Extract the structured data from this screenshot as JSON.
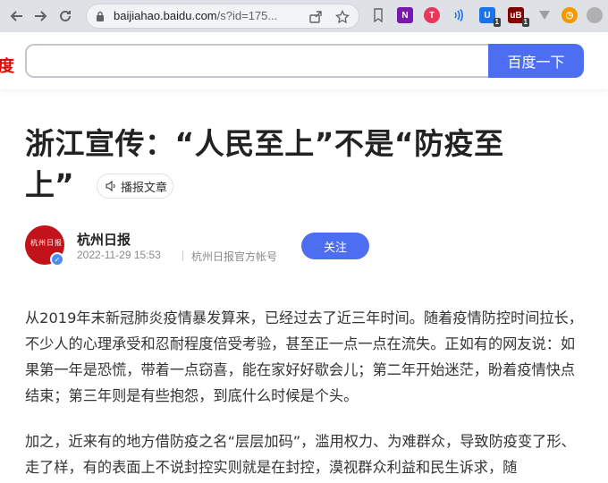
{
  "browser": {
    "url_host": "baijiahao.baidu.com",
    "url_path": "/s?id=175...",
    "icons": [
      "back-arrow-icon",
      "forward-arrow-icon",
      "reload-icon",
      "lock-icon",
      "share-icon",
      "star-icon",
      "bookmark-icon",
      "onenote-icon",
      "extension-red-icon",
      "wifi-icon",
      "extension-blue-icon",
      "extension-ublock-icon",
      "extension-v-icon",
      "extension-orange-icon"
    ],
    "badge_1": "1",
    "badge_2": "1"
  },
  "search": {
    "logo_fragment": "度",
    "button_label": "百度一下",
    "query": ""
  },
  "article": {
    "title_line1": "浙江宣传：“人民至上”不是“防疫至",
    "title_line2": "上”",
    "audio_label": "播报文章",
    "author": "杭州日报",
    "avatar_text": "杭州日报",
    "date": "2022-11-29 15:53",
    "account_type": "杭州日报官方帐号",
    "follow_label": "关注",
    "paragraph1": "从2019年末新冠肺炎疫情暴发算来，已经过去了近三年时间。随着疫情防控时间拉长，不少人的心理承受和忍耐程度倍受考验，甚至正一点一点在流失。正如有的网友说：如果第一年是恐慌，带着一点窃喜，能在家好好歇会儿；第二年开始迷茫，盼着疫情快点结束；第三年则是有些抱怨，到底什么时候是个头。",
    "paragraph2": "加之，近来有的地方借防疫之名“层层加码”，滥用权力、为难群众，导致防疫变了形、走了样，有的表面上不说封控实则就是在封控，漠视群众利益和民生诉求，随"
  },
  "colors": {
    "accent": "#4e6ef2",
    "logo_red": "#e10601",
    "avatar_red": "#c2121a"
  }
}
